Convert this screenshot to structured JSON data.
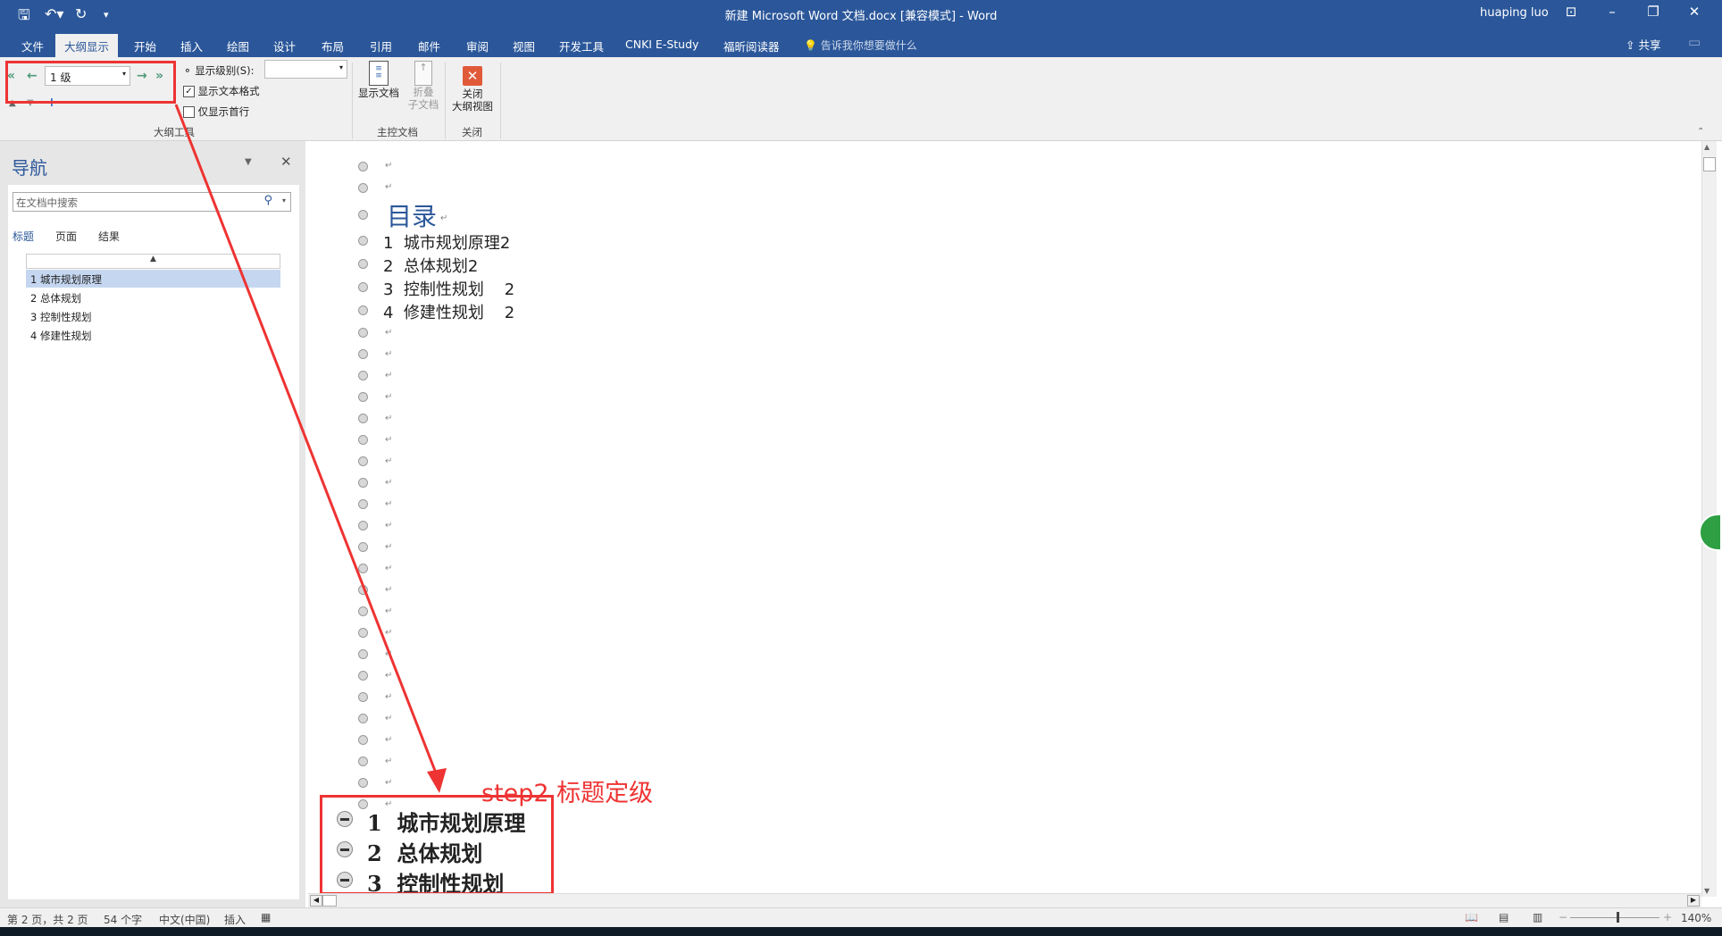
{
  "titlebar": {
    "title": "新建 Microsoft Word 文档.docx [兼容模式]  -  Word",
    "user": "huaping luo",
    "share": "共享"
  },
  "tabs": [
    "文件",
    "大纲显示",
    "开始",
    "插入",
    "绘图",
    "设计",
    "布局",
    "引用",
    "邮件",
    "审阅",
    "视图",
    "开发工具",
    "CNKI E-Study",
    "福昕阅读器"
  ],
  "active_tab": "大纲显示",
  "tell_me": "告诉我你想要做什么",
  "ribbon": {
    "level_value": "1 级",
    "show_level_label": "显示级别(S):",
    "show_level_value": "",
    "show_text_format": {
      "label": "显示文本格式",
      "checked": true
    },
    "show_first_line": {
      "label": "仅显示首行",
      "checked": false
    },
    "outline_tools_label": "大纲工具",
    "show_document": "显示文档",
    "collapse_subdocs": "折叠\n子文档",
    "collapse_1": "折叠",
    "collapse_2": "子文档",
    "master_doc_label": "主控文档",
    "close_1": "关闭",
    "close_2": "大纲视图",
    "close_group_label": "关闭"
  },
  "nav": {
    "title": "导航",
    "search_placeholder": "在文档中搜索",
    "tabs": [
      "标题",
      "页面",
      "结果"
    ],
    "active_tab": "标题",
    "items": [
      "1 城市规划原理",
      "2 总体规划",
      "3 控制性规划",
      "4 修建性规划"
    ],
    "selected": 0
  },
  "document": {
    "toc_title": "目录",
    "toc": [
      "1  城市规划原理2",
      "2  总体规划2",
      "3  控制性规划    2",
      "4  修建性规划    2"
    ],
    "empty_rows_before_toc": 2,
    "empty_rows_after_toc": 23,
    "headings": [
      "1  城市规划原理",
      "2  总体规划",
      "3  控制性规划"
    ],
    "paragraph_mark": "↵"
  },
  "annotation": {
    "text": "step2 标题定级",
    "color": "#ee3333"
  },
  "statusbar": {
    "page": "第 2 页，共 2 页",
    "words": "54 个字",
    "language": "中文(中国)",
    "mode": "插入",
    "zoom": "140%"
  },
  "colors": {
    "brand": "#2b579a",
    "annotation": "#ee3333"
  }
}
